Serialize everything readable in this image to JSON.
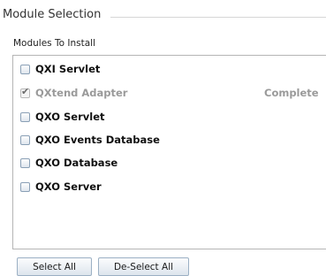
{
  "group": {
    "title": "Module Selection"
  },
  "modules": {
    "label": "Modules To Install",
    "items": [
      {
        "name": "QXI Servlet",
        "checked": false,
        "disabled": false,
        "status": ""
      },
      {
        "name": "QXtend Adapter",
        "checked": true,
        "disabled": true,
        "status": "Complete"
      },
      {
        "name": "QXO Servlet",
        "checked": false,
        "disabled": false,
        "status": ""
      },
      {
        "name": "QXO Events Database",
        "checked": false,
        "disabled": false,
        "status": ""
      },
      {
        "name": "QXO Database",
        "checked": false,
        "disabled": false,
        "status": ""
      },
      {
        "name": "QXO Server",
        "checked": false,
        "disabled": false,
        "status": ""
      }
    ]
  },
  "buttons": {
    "select_all": "Select All",
    "deselect_all": "De-Select All"
  }
}
